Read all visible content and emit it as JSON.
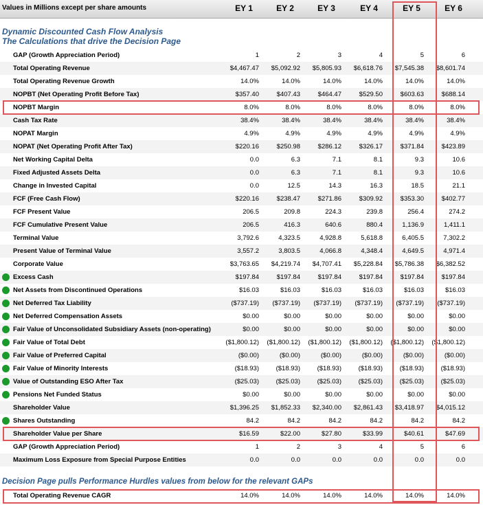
{
  "header": {
    "label": "Values in Millions except per share amounts",
    "years": [
      "EY 1",
      "EY 2",
      "EY 3",
      "EY 4",
      "EY 5",
      "EY 6"
    ]
  },
  "section1": {
    "title_line1": "Dynamic Discounted Cash Flow Analysis",
    "title_line2": "The Calculations that drive the Decision Page"
  },
  "rows": [
    {
      "label": "GAP (Growth Appreciation Period)",
      "values": [
        "1",
        "2",
        "3",
        "4",
        "5",
        "6"
      ]
    },
    {
      "label": "Total Operating Revenue",
      "values": [
        "$4,467.47",
        "$5,092.92",
        "$5,805.93",
        "$6,618.76",
        "$7,545.38",
        "$8,601.74"
      ]
    },
    {
      "label": "Total Operating Revenue Growth",
      "values": [
        "14.0%",
        "14.0%",
        "14.0%",
        "14.0%",
        "14.0%",
        "14.0%"
      ]
    },
    {
      "label": "NOPBT (Net Operating Profit Before Tax)",
      "values": [
        "$357.40",
        "$407.43",
        "$464.47",
        "$529.50",
        "$603.63",
        "$688.14"
      ]
    },
    {
      "label": "NOPBT Margin",
      "values": [
        "8.0%",
        "8.0%",
        "8.0%",
        "8.0%",
        "8.0%",
        "8.0%"
      ]
    },
    {
      "label": "Cash Tax Rate",
      "values": [
        "38.4%",
        "38.4%",
        "38.4%",
        "38.4%",
        "38.4%",
        "38.4%"
      ]
    },
    {
      "label": "NOPAT Margin",
      "values": [
        "4.9%",
        "4.9%",
        "4.9%",
        "4.9%",
        "4.9%",
        "4.9%"
      ]
    },
    {
      "label": "NOPAT (Net Operating Profit After Tax)",
      "values": [
        "$220.16",
        "$250.98",
        "$286.12",
        "$326.17",
        "$371.84",
        "$423.89"
      ]
    },
    {
      "label": "Net Working Capital Delta",
      "values": [
        "0.0",
        "6.3",
        "7.1",
        "8.1",
        "9.3",
        "10.6"
      ]
    },
    {
      "label": "Fixed Adjusted Assets Delta",
      "values": [
        "0.0",
        "6.3",
        "7.1",
        "8.1",
        "9.3",
        "10.6"
      ]
    },
    {
      "label": "Change in Invested Capital",
      "values": [
        "0.0",
        "12.5",
        "14.3",
        "16.3",
        "18.5",
        "21.1"
      ]
    },
    {
      "label": "FCF (Free Cash Flow)",
      "values": [
        "$220.16",
        "$238.47",
        "$271.86",
        "$309.92",
        "$353.30",
        "$402.77"
      ]
    },
    {
      "label": "FCF Present Value",
      "values": [
        "206.5",
        "209.8",
        "224.3",
        "239.8",
        "256.4",
        "274.2"
      ]
    },
    {
      "label": "FCF Cumulative Present Value",
      "values": [
        "206.5",
        "416.3",
        "640.6",
        "880.4",
        "1,136.9",
        "1,411.1"
      ]
    },
    {
      "label": "Terminal Value",
      "values": [
        "3,792.6",
        "4,323.5",
        "4,928.8",
        "5,618.8",
        "6,405.5",
        "7,302.2"
      ]
    },
    {
      "label": "Present Value of Terminal Value",
      "values": [
        "3,557.2",
        "3,803.5",
        "4,066.8",
        "4,348.4",
        "4,649.5",
        "4,971.4"
      ]
    },
    {
      "label": "Corporate Value",
      "values": [
        "$3,763.65",
        "$4,219.74",
        "$4,707.41",
        "$5,228.84",
        "$5,786.38",
        "$6,382.52"
      ]
    },
    {
      "label": "Excess Cash",
      "dot": true,
      "values": [
        "$197.84",
        "$197.84",
        "$197.84",
        "$197.84",
        "$197.84",
        "$197.84"
      ]
    },
    {
      "label": "Net Assets from Discontinued Operations",
      "dot": true,
      "values": [
        "$16.03",
        "$16.03",
        "$16.03",
        "$16.03",
        "$16.03",
        "$16.03"
      ]
    },
    {
      "label": "Net Deferred Tax Liability",
      "dot": true,
      "values": [
        "($737.19)",
        "($737.19)",
        "($737.19)",
        "($737.19)",
        "($737.19)",
        "($737.19)"
      ]
    },
    {
      "label": "Net Deferred Compensation Assets",
      "dot": true,
      "values": [
        "$0.00",
        "$0.00",
        "$0.00",
        "$0.00",
        "$0.00",
        "$0.00"
      ]
    },
    {
      "label": "Fair Value of Unconsolidated Subsidiary Assets (non-operating)",
      "dot": true,
      "values": [
        "$0.00",
        "$0.00",
        "$0.00",
        "$0.00",
        "$0.00",
        "$0.00"
      ]
    },
    {
      "label": "Fair Value of Total Debt",
      "dot": true,
      "values": [
        "($1,800.12)",
        "($1,800.12)",
        "($1,800.12)",
        "($1,800.12)",
        "($1,800.12)",
        "($1,800.12)"
      ]
    },
    {
      "label": "Fair Value of Preferred Capital",
      "dot": true,
      "values": [
        "($0.00)",
        "($0.00)",
        "($0.00)",
        "($0.00)",
        "($0.00)",
        "($0.00)"
      ]
    },
    {
      "label": "Fair Value of Minority Interests",
      "dot": true,
      "values": [
        "($18.93)",
        "($18.93)",
        "($18.93)",
        "($18.93)",
        "($18.93)",
        "($18.93)"
      ]
    },
    {
      "label": "Value of Outstanding ESO After Tax",
      "dot": true,
      "values": [
        "($25.03)",
        "($25.03)",
        "($25.03)",
        "($25.03)",
        "($25.03)",
        "($25.03)"
      ]
    },
    {
      "label": "Pensions Net Funded Status",
      "dot": true,
      "values": [
        "$0.00",
        "$0.00",
        "$0.00",
        "$0.00",
        "$0.00",
        "$0.00"
      ]
    },
    {
      "label": "Shareholder Value",
      "values": [
        "$1,396.25",
        "$1,852.33",
        "$2,340.00",
        "$2,861.43",
        "$3,418.97",
        "$4,015.12"
      ]
    },
    {
      "label": "Shares Outstanding",
      "dot": true,
      "values": [
        "84.2",
        "84.2",
        "84.2",
        "84.2",
        "84.2",
        "84.2"
      ]
    },
    {
      "label": "Shareholder Value per Share",
      "values": [
        "$16.59",
        "$22.00",
        "$27.80",
        "$33.99",
        "$40.61",
        "$47.69"
      ]
    },
    {
      "label": "GAP (Growth Appreciation Period)",
      "values": [
        "1",
        "2",
        "3",
        "4",
        "5",
        "6"
      ]
    },
    {
      "label": "Maximum Loss Exposure from Special Purpose Entities",
      "values": [
        "0.0",
        "0.0",
        "0.0",
        "0.0",
        "0.0",
        "0.0"
      ]
    }
  ],
  "section2": {
    "title": "Decision Page pulls Performance Hurdles values from below for the relevant GAPs"
  },
  "cagr_row": {
    "label": "Total Operating Revenue CAGR",
    "values": [
      "14.0%",
      "14.0%",
      "14.0%",
      "14.0%",
      "14.0%",
      "14.0%"
    ]
  },
  "highlight_color": "#e0555a",
  "dot_color": "#1a9a2a"
}
